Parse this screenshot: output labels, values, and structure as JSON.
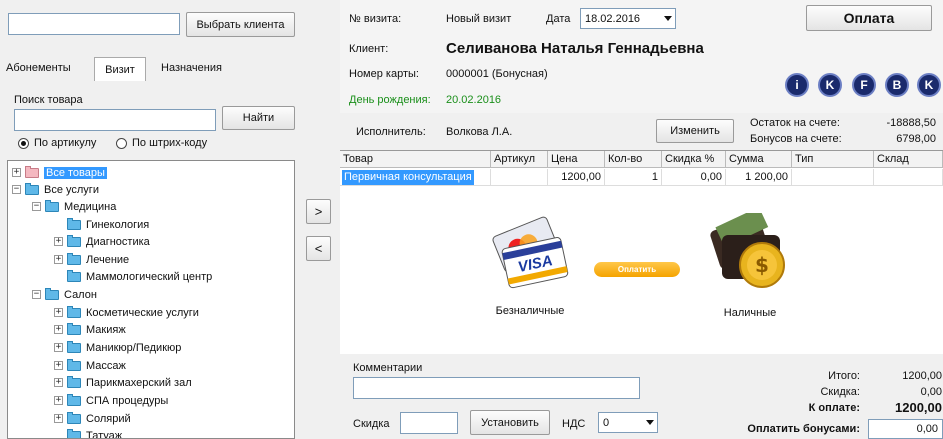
{
  "left": {
    "choose_client_button": "Выбрать клиента",
    "tabs": [
      "Абонементы",
      "Визит",
      "Назначения"
    ],
    "search_label": "Поиск товара",
    "find_button": "Найти",
    "radio_article": "По артикулу",
    "radio_barcode": "По штрих-коду",
    "tree": [
      {
        "label": "Все товары",
        "expander": "+",
        "folder": "pink",
        "selected": true
      },
      {
        "label": "Все услуги",
        "expander": "−"
      },
      {
        "label": "Медицина",
        "expander": "−"
      },
      {
        "label": "Гинекология",
        "expander": ""
      },
      {
        "label": "Диагностика",
        "expander": "+"
      },
      {
        "label": "Лечение",
        "expander": "+"
      },
      {
        "label": "Маммологический центр",
        "expander": ""
      },
      {
        "label": "Салон",
        "expander": "−"
      },
      {
        "label": "Косметические услуги",
        "expander": "+"
      },
      {
        "label": "Макияж",
        "expander": "+"
      },
      {
        "label": "Маникюр/Педикюр",
        "expander": "+"
      },
      {
        "label": "Массаж",
        "expander": "+"
      },
      {
        "label": "Парикмахерский зал",
        "expander": "+"
      },
      {
        "label": "СПА процедуры",
        "expander": "+"
      },
      {
        "label": "Солярий",
        "expander": "+"
      },
      {
        "label": "Татуаж",
        "expander": ""
      }
    ]
  },
  "arrows": {
    "right": ">",
    "left": "<"
  },
  "header": {
    "visit_no_label": "№ визита:",
    "visit_no_value": "Новый визит",
    "date_label": "Дата",
    "date_value": "18.02.2016",
    "pay_button": "Оплата",
    "client_label": "Клиент:",
    "client_name": "Селиванова Наталья Геннадьевна",
    "card_label": "Номер карты:",
    "card_value": "0000001 (Бонусная)",
    "birthday_label": "День рождения:",
    "birthday_value": "20.02.2016",
    "round_icons": [
      "i",
      "K",
      "F",
      "B",
      "K"
    ]
  },
  "executor": {
    "label": "Исполнитель:",
    "value": "Волкова Л.А.",
    "change_button": "Изменить",
    "balance_label": "Остаток на счете:",
    "balance_value": "-18888,50",
    "bonus_label": "Бонусов на счете:",
    "bonus_value": "6798,00"
  },
  "table": {
    "columns": [
      "Товар",
      "Артикул",
      "Цена",
      "Кол-во",
      "Скидка %",
      "Сумма",
      "Тип",
      "Склад"
    ],
    "rows": [
      [
        "Первичная консультация",
        "",
        "1200,00",
        "1",
        "0,00",
        "1 200,00",
        "",
        ""
      ]
    ]
  },
  "payment": {
    "cashless_label": "Безналичные",
    "card_text": "VISA",
    "pay_pill": "Оплатить",
    "cash_label": "Наличные"
  },
  "footer": {
    "comment_label": "Комментарии",
    "discount_label": "Скидка",
    "set_button": "Установить",
    "vat_label": "НДС",
    "vat_value": "0",
    "total_label": "Итого:",
    "total_value": "1200,00",
    "discount_sum_label": "Скидка:",
    "discount_sum_value": "0,00",
    "to_pay_label": "К оплате:",
    "to_pay_value": "1200,00",
    "pay_bonus_label": "Оплатить бонусами:",
    "pay_bonus_value": "0,00"
  },
  "colors": {
    "selection": "#3399ff",
    "birthday": "#1a8f1a",
    "pill": "#f5a300"
  }
}
